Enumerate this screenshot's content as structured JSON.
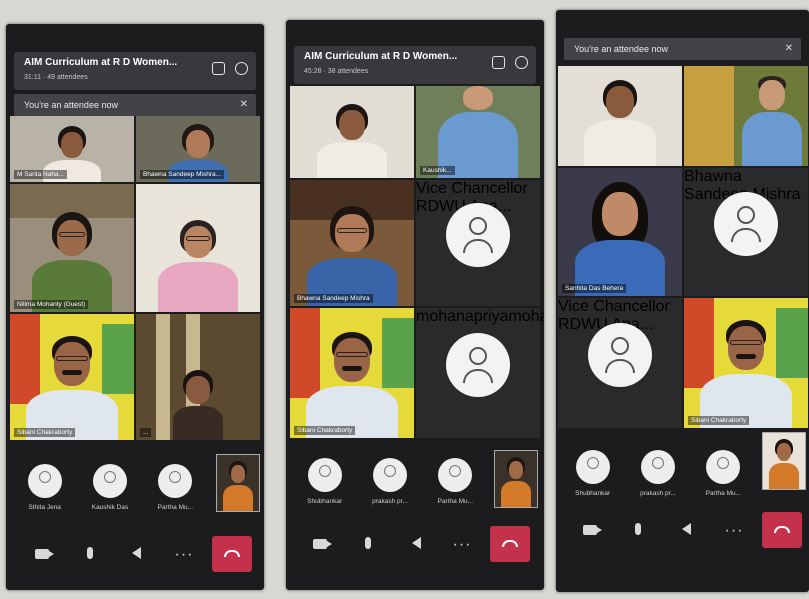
{
  "colors": {
    "panel": "#1c1c1e",
    "hangup": "#c4314b",
    "bar": "#3c3c40"
  },
  "screens": [
    {
      "title": "AIM Curriculum at R D Women...",
      "subtitle": "31:11 · 49 attendees",
      "notice": "You're an attendee now",
      "tiles": [
        "M Sarita Naha...",
        "Bhawna Sandeep Mishra...",
        "Nilima Mohanty (Guest)",
        "",
        "Sibani Chakraborty",
        "..."
      ],
      "roster": [
        "Sthita Jena",
        "Kaushik Das",
        "Partha Mu..."
      ],
      "controls": [
        "camera-icon",
        "mic-icon",
        "speaker-icon",
        "more-icon",
        "hangup-icon"
      ]
    },
    {
      "title": "AIM Curriculum at R D Women...",
      "subtitle": "45:28 · 38 attendees",
      "tiles": [
        "",
        "Kaushik...",
        "Bhawna Sandeep Mishra",
        "Vice Chancellor RDWU Apa...",
        "Sibani Chakraborty",
        "mohanapriyamohapatra..."
      ],
      "roster": [
        "Shubhankar",
        "prakash pr...",
        "Partha Mu..."
      ],
      "controls": [
        "camera-icon",
        "mic-icon",
        "speaker-icon",
        "more-icon",
        "hangup-icon"
      ]
    },
    {
      "notice": "You're an attendee now",
      "tiles": [
        "",
        "",
        "Sanhita Das Behera",
        "Bhawna Sandeep Mishra",
        "Vice Chancellor RDWU Apa...",
        "Sibani Chakraborty"
      ],
      "roster": [
        "Shubhankar",
        "prakash pr...",
        "Partha Mu..."
      ],
      "controls": [
        "camera-icon",
        "mic-icon",
        "speaker-icon",
        "more-icon",
        "hangup-icon"
      ]
    }
  ]
}
